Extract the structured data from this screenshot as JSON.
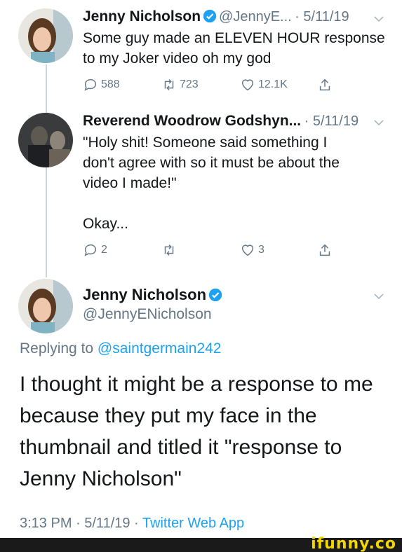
{
  "tweets": [
    {
      "name": "Jenny Nicholson",
      "handle": "@JennyE...",
      "date": "· 5/11/19",
      "text": "Some guy made an ELEVEN HOUR response to my Joker video oh my god",
      "replies": "588",
      "retweets": "723",
      "likes": "12.1K"
    },
    {
      "name": "Reverend Woodrow Godshyn...",
      "date": "· 5/11/19",
      "text_lines": [
        "\"Holy shit! Someone said something I",
        "don't agree with so it must be about the",
        "video I made!\""
      ],
      "text2": "Okay...",
      "replies": "2",
      "likes": "3"
    }
  ],
  "main_tweet": {
    "name": "Jenny Nicholson",
    "handle": "@JennyENicholson",
    "replying_prefix": "Replying to",
    "replying_to": "@saintgermain242",
    "text": "I thought it might be a response to me because they put my face in the thumbnail and titled it \"response to Jenny Nicholson\"",
    "time": "3:13 PM · 5/11/19 ·",
    "app": "Twitter Web App"
  },
  "watermark": "ifunny.co",
  "colors": {
    "accent": "#1da1f2",
    "muted": "#657786",
    "text": "#14171a",
    "watermark": "#f2d600"
  }
}
